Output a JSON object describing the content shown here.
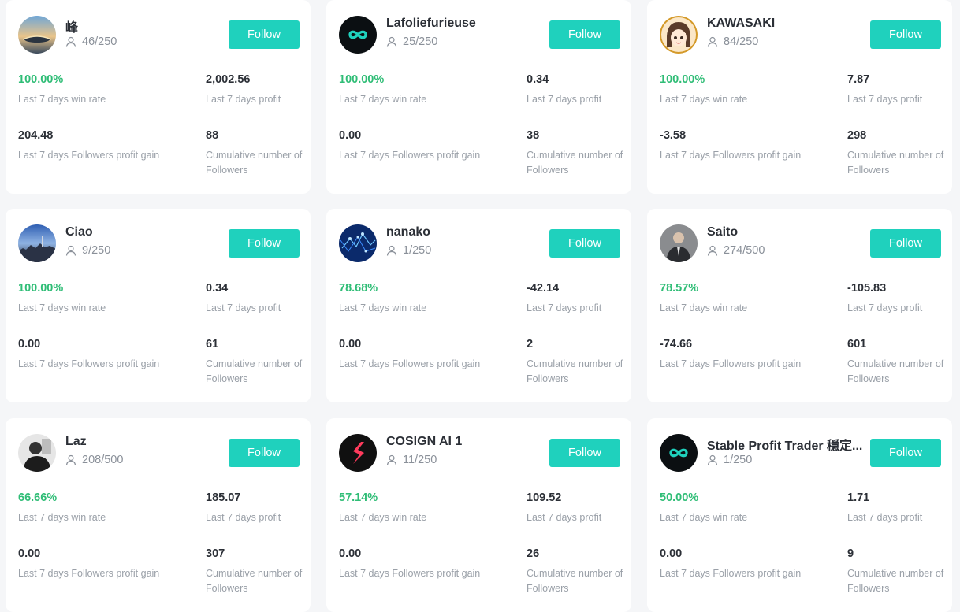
{
  "labels": {
    "win_rate": "Last 7 days win rate",
    "profit": "Last 7 days profit",
    "followers_gain": "Last 7 days Followers profit gain",
    "cumulative": "Cumulative number of Followers"
  },
  "colors": {
    "accent": "#1fd1bd",
    "positive": "#2fbd76",
    "text": "#2b2f36",
    "muted": "#9aa0a8"
  },
  "traders": [
    {
      "name": "峰",
      "quota": "46/250",
      "follow_label": "Follow",
      "win_rate": "100.00%",
      "profit": "2,002.56",
      "followers_gain": "204.48",
      "cumulative": "88",
      "avatar_icon": "sunset-landscape-avatar"
    },
    {
      "name": "Lafoliefurieuse",
      "quota": "25/250",
      "follow_label": "Follow",
      "win_rate": "100.00%",
      "profit": "0.34",
      "followers_gain": "0.00",
      "cumulative": "38",
      "avatar_icon": "infinity-logo-avatar"
    },
    {
      "name": "KAWASAKI",
      "quota": "84/250",
      "follow_label": "Follow",
      "win_rate": "100.00%",
      "profit": "7.87",
      "followers_gain": "-3.58",
      "cumulative": "298",
      "avatar_icon": "anime-girl-avatar"
    },
    {
      "name": "Ciao",
      "quota": "9/250",
      "follow_label": "Follow",
      "win_rate": "100.00%",
      "profit": "0.34",
      "followers_gain": "0.00",
      "cumulative": "61",
      "avatar_icon": "city-skyline-avatar"
    },
    {
      "name": "nanako",
      "quota": "1/250",
      "follow_label": "Follow",
      "win_rate": "78.68%",
      "profit": "-42.14",
      "followers_gain": "0.00",
      "cumulative": "2",
      "avatar_icon": "blue-network-avatar"
    },
    {
      "name": "Saito",
      "quota": "274/500",
      "follow_label": "Follow",
      "win_rate": "78.57%",
      "profit": "-105.83",
      "followers_gain": "-74.66",
      "cumulative": "601",
      "avatar_icon": "man-in-suit-avatar"
    },
    {
      "name": "Laz",
      "quota": "208/500",
      "follow_label": "Follow",
      "win_rate": "66.66%",
      "profit": "185.07",
      "followers_gain": "0.00",
      "cumulative": "307",
      "avatar_icon": "bw-portrait-avatar"
    },
    {
      "name": "COSIGN AI 1",
      "quota": "11/250",
      "follow_label": "Follow",
      "win_rate": "57.14%",
      "profit": "109.52",
      "followers_gain": "0.00",
      "cumulative": "26",
      "avatar_icon": "cosign-logo-avatar"
    },
    {
      "name": "Stable Profit Trader 穩定...",
      "quota": "1/250",
      "follow_label": "Follow",
      "win_rate": "50.00%",
      "profit": "1.71",
      "followers_gain": "0.00",
      "cumulative": "9",
      "avatar_icon": "infinity-logo-avatar"
    }
  ]
}
